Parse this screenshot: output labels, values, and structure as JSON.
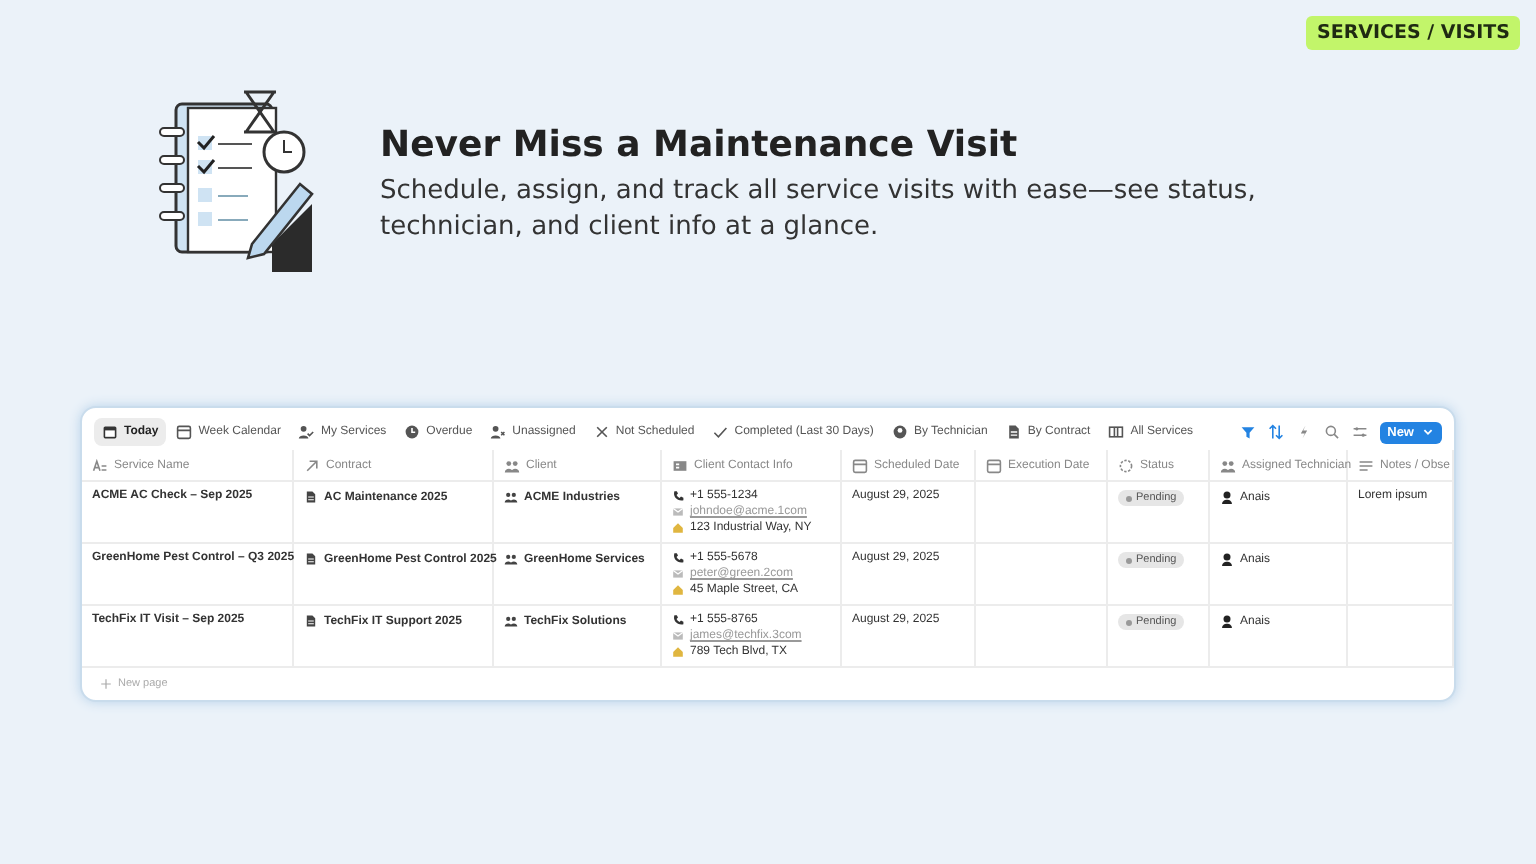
{
  "badge": "SERVICES / VISITS",
  "hero": {
    "title": "Never Miss a Maintenance Visit",
    "subtitle": "Schedule, assign, and track all service visits with ease—see status, technician, and client info at a glance."
  },
  "tabs": [
    {
      "label": "Today",
      "selected": true
    },
    {
      "label": "Week Calendar",
      "selected": false
    },
    {
      "label": "My Services",
      "selected": false
    },
    {
      "label": "Overdue",
      "selected": false
    },
    {
      "label": "Unassigned",
      "selected": false
    },
    {
      "label": "Not Scheduled",
      "selected": false
    },
    {
      "label": "Completed (Last 30 Days)",
      "selected": false
    },
    {
      "label": "By Technician",
      "selected": false
    },
    {
      "label": "By Contract",
      "selected": false
    },
    {
      "label": "All Services",
      "selected": false
    }
  ],
  "new_button": "New",
  "table": {
    "columns": [
      "Service Name",
      "Contract",
      "Client",
      "Client Contact Info",
      "Scheduled Date",
      "Execution Date",
      "Status",
      "Assigned Technician",
      "Notes / Obse"
    ],
    "rows": [
      {
        "service": "ACME AC Check – Sep 2025",
        "contract": "AC Maintenance 2025",
        "client": "ACME Industries",
        "phone": "+1 555-1234",
        "email": "johndoe@acme.1com",
        "address": "123 Industrial Way, NY",
        "scheduled": "August 29, 2025",
        "status": "Pending",
        "technician": "Anais",
        "notes": "Lorem ipsum"
      },
      {
        "service": "GreenHome Pest Control – Q3 2025",
        "contract": "GreenHome Pest Control 2025",
        "client": "GreenHome Services",
        "phone": "+1 555-5678",
        "email": "peter@green.2com",
        "address": "45 Maple Street, CA",
        "scheduled": "August 29, 2025",
        "status": "Pending",
        "technician": "Anais"
      },
      {
        "service": "TechFix IT Visit – Sep 2025",
        "contract": "TechFix IT Support 2025",
        "client": "TechFix Solutions",
        "phone": "+1 555-8765",
        "email": "james@techfix.3com",
        "address": "789 Tech Blvd, TX",
        "scheduled": "August 29, 2025",
        "status": "Pending",
        "technician": "Anais"
      }
    ],
    "new_row": "New page"
  }
}
